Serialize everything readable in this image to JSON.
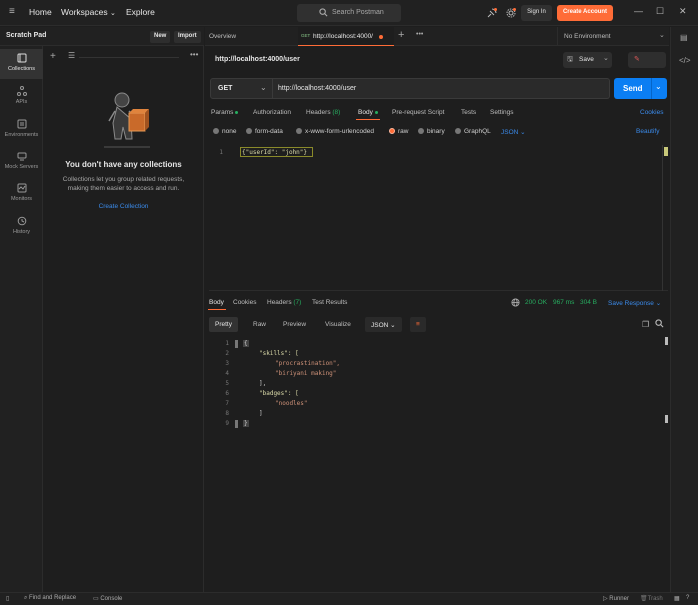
{
  "topbar": {
    "home": "Home",
    "workspaces": "Workspaces",
    "explore": "Explore",
    "search_placeholder": "Search Postman",
    "sign_in": "Sign In",
    "create_account": "Create Account"
  },
  "sidebar": {
    "title": "Scratch Pad",
    "new_label": "New",
    "import_label": "Import",
    "rail": [
      {
        "label": "Collections"
      },
      {
        "label": "APIs"
      },
      {
        "label": "Environments"
      },
      {
        "label": "Mock Servers"
      },
      {
        "label": "Monitors"
      },
      {
        "label": "History"
      }
    ],
    "empty_title": "You don't have any collections",
    "empty_desc_1": "Collections let you group related requests,",
    "empty_desc_2": "making them easier to access and run.",
    "create_collection": "Create Collection"
  },
  "tabs": {
    "overview": "Overview",
    "active_method": "GET",
    "active_url": "http://localhost:4000/",
    "environment": "No Environment"
  },
  "request": {
    "title": "http://localhost:4000/user",
    "save_label": "Save",
    "method": "GET",
    "url": "http://localhost:4000/user",
    "send_label": "Send",
    "cookies_label": "Cookies",
    "tabs": [
      "Params",
      "Authorization",
      "Headers",
      "Body",
      "Pre-request Script",
      "Tests",
      "Settings"
    ],
    "headers_count": "(8)",
    "body_types": [
      "none",
      "form-data",
      "x-www-form-urlencoded",
      "raw",
      "binary",
      "GraphQL"
    ],
    "body_format": "JSON",
    "beautify_label": "Beautify",
    "body_line_number": "1",
    "body_text": "{\"userId\": \"john\"}"
  },
  "response": {
    "tabs": [
      "Body",
      "Cookies",
      "Headers",
      "Test Results"
    ],
    "headers_count": "(7)",
    "status": "200 OK",
    "time": "967 ms",
    "size": "304 B",
    "save_response": "Save Response",
    "views": [
      "Pretty",
      "Raw",
      "Preview",
      "Visualize"
    ],
    "format": "JSON",
    "line_numbers": [
      "1",
      "2",
      "3",
      "4",
      "5",
      "6",
      "7",
      "8",
      "9"
    ],
    "lines": [
      "{",
      "\"skills\": [",
      "\"procrastination\",",
      "\"biriyani making\"",
      "],",
      "\"badges\": [",
      "\"noodles\"",
      "]",
      "}"
    ]
  },
  "statusbar": {
    "find_replace": "Find and Replace",
    "console": "Console",
    "runner": "Runner",
    "trash": "Trash"
  },
  "colors": {
    "accent": "#ff6c37",
    "send": "#0b7ef3",
    "success": "#27ae60",
    "link": "#3b8beb"
  }
}
